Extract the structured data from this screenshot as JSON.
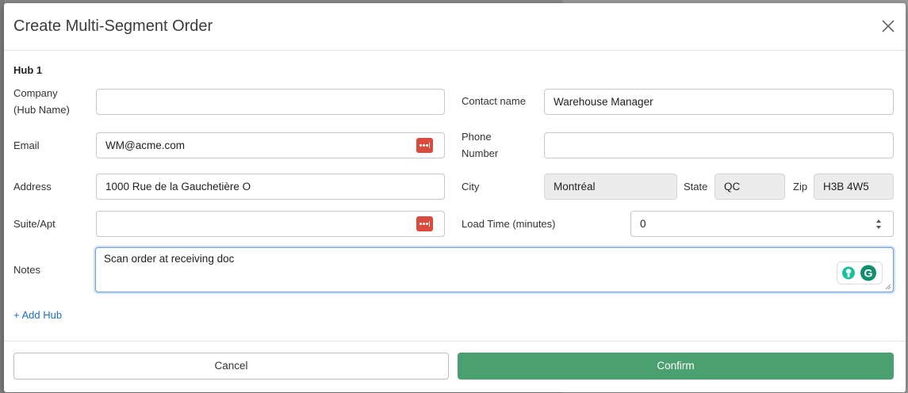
{
  "modal": {
    "title": "Create Multi-Segment Order",
    "close_icon": "close-icon"
  },
  "hub": {
    "title": "Hub 1",
    "company_label_line1": "Company",
    "company_label_line2": "(Hub Name)",
    "company_value": "",
    "contact_label": "Contact name",
    "contact_value": "Warehouse Manager",
    "email_label": "Email",
    "email_value": "WM@acme.com",
    "phone_label_line1": "Phone",
    "phone_label_line2": "Number",
    "phone_value": "",
    "address_label": "Address",
    "address_value": "1000 Rue de la Gauchetière O",
    "city_label": "City",
    "city_value": "Montréal",
    "state_label": "State",
    "state_value": "QC",
    "zip_label": "Zip",
    "zip_value": "H3B 4W5",
    "suite_label": "Suite/Apt",
    "suite_value": "",
    "load_time_label": "Load Time (minutes)",
    "load_time_value": "0",
    "notes_label": "Notes",
    "notes_value": "Scan order at receiving doc"
  },
  "actions": {
    "add_hub": "+ Add Hub",
    "cancel": "Cancel",
    "confirm": "Confirm"
  },
  "icons": {
    "password_manager": "password-manager-icon",
    "grammarly": "grammarly-icon"
  },
  "colors": {
    "confirm": "#4aa06e",
    "link": "#1a6fc0",
    "password_icon": "#d94c3d",
    "focus_border": "#6d9fd8"
  }
}
